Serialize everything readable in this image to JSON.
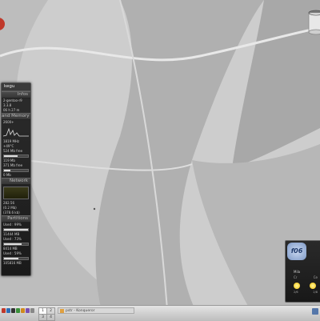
{
  "colors": {
    "wallpaper_dark": "#9a9a9a",
    "wallpaper_light": "#e6e6e6",
    "gadget_bg": "#222222",
    "accent_red": "#c0392b"
  },
  "sysmon": {
    "title": "kegu",
    "sections": {
      "infos": "Infos",
      "memory": "and Memory",
      "network": "Network",
      "partitions": "Partitions"
    },
    "info_lines": [
      "2-gentoo-r9",
      "3.3.8",
      "06 h 27 m"
    ],
    "cpu_lines": [
      "2600+",
      "1819 MHz",
      "+49°C",
      "77%"
    ],
    "mem_lines": [
      "524 Mb free",
      "119 Mb",
      "371 Mb free",
      "0 Mb"
    ],
    "mem_bars": [
      0.55,
      0.25
    ],
    "net_lines": [
      "282.56",
      "(0.2 Mb)",
      "(378.6 kb)"
    ],
    "partition_lines": [
      "Used : 99%",
      "11444 MB",
      "Used : 73%",
      "8414 MB",
      "Used : 59%",
      "105816 MB"
    ],
    "partition_bars": [
      0.99,
      0.73,
      0.59
    ]
  },
  "weather": {
    "title": "f06",
    "city": "Mila",
    "days": [
      "Cr",
      "Ce"
    ],
    "temps": [
      "2/6",
      "2/8"
    ]
  },
  "taskbar": {
    "pagers": [
      "1",
      "2",
      "3",
      "4"
    ],
    "task_label": "pstr - Konqueror"
  }
}
